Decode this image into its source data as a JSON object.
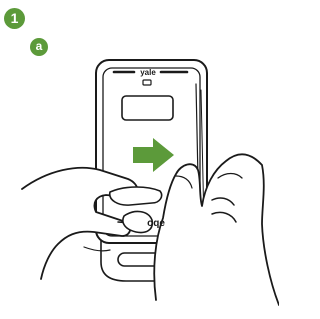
{
  "step_number": "1",
  "substep_label": "a",
  "device_brand": "yale",
  "device_front_logo": "oqe",
  "colors": {
    "badge": "#5c9a3a",
    "arrow": "#5c9a3a",
    "line": "#1a1a1a",
    "fill": "#ffffff"
  }
}
